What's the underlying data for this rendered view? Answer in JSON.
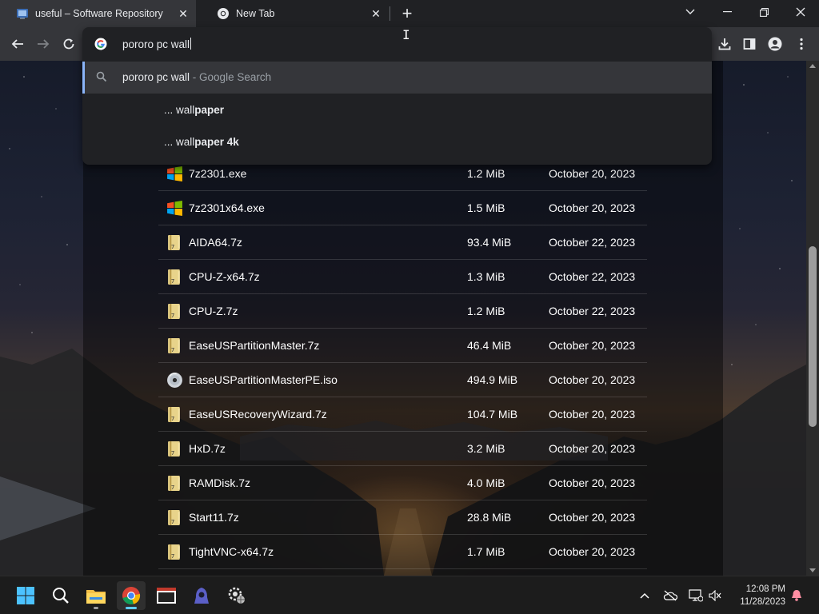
{
  "tabs": [
    {
      "title": "useful – Software Repository",
      "icon": "repo-favicon",
      "active": true
    },
    {
      "title": "New Tab",
      "icon": "chrome-favicon",
      "active": false
    }
  ],
  "omnibox": {
    "value": "pororo pc wall",
    "suggestions": [
      {
        "query": "pororo pc wall",
        "suffix": " - Google Search",
        "icon": "search-icon"
      },
      {
        "prefix": "... wall",
        "bold": "paper"
      },
      {
        "prefix": "... wall",
        "bold": "paper 4k"
      }
    ]
  },
  "files": [
    {
      "name": "7z2301.exe",
      "size": "1.2 MiB",
      "date": "October 20, 2023",
      "type": "exe"
    },
    {
      "name": "7z2301x64.exe",
      "size": "1.5 MiB",
      "date": "October 20, 2023",
      "type": "exe"
    },
    {
      "name": "AIDA64.7z",
      "size": "93.4 MiB",
      "date": "October 22, 2023",
      "type": "7z"
    },
    {
      "name": "CPU-Z-x64.7z",
      "size": "1.3 MiB",
      "date": "October 22, 2023",
      "type": "7z"
    },
    {
      "name": "CPU-Z.7z",
      "size": "1.2 MiB",
      "date": "October 22, 2023",
      "type": "7z"
    },
    {
      "name": "EaseUSPartitionMaster.7z",
      "size": "46.4 MiB",
      "date": "October 20, 2023",
      "type": "7z"
    },
    {
      "name": "EaseUSPartitionMasterPE.iso",
      "size": "494.9 MiB",
      "date": "October 20, 2023",
      "type": "iso"
    },
    {
      "name": "EaseUSRecoveryWizard.7z",
      "size": "104.7 MiB",
      "date": "October 20, 2023",
      "type": "7z"
    },
    {
      "name": "HxD.7z",
      "size": "3.2 MiB",
      "date": "October 20, 2023",
      "type": "7z"
    },
    {
      "name": "RAMDisk.7z",
      "size": "4.0 MiB",
      "date": "October 20, 2023",
      "type": "7z"
    },
    {
      "name": "Start11.7z",
      "size": "28.8 MiB",
      "date": "October 20, 2023",
      "type": "7z"
    },
    {
      "name": "TightVNC-x64.7z",
      "size": "1.7 MiB",
      "date": "October 20, 2023",
      "type": "7z"
    }
  ],
  "taskbar": {
    "apps": [
      "windows-start-icon",
      "search-icon",
      "file-explorer-icon",
      "chrome-icon",
      "terminal-app-icon",
      "hooded-figure-app-icon",
      "gear-globe-app-icon"
    ],
    "time": "12:08 PM",
    "date": "11/28/2023"
  },
  "colors": {
    "accent": "#8ab4f8",
    "toolbar": "#35363a",
    "tabstrip": "#202124"
  }
}
